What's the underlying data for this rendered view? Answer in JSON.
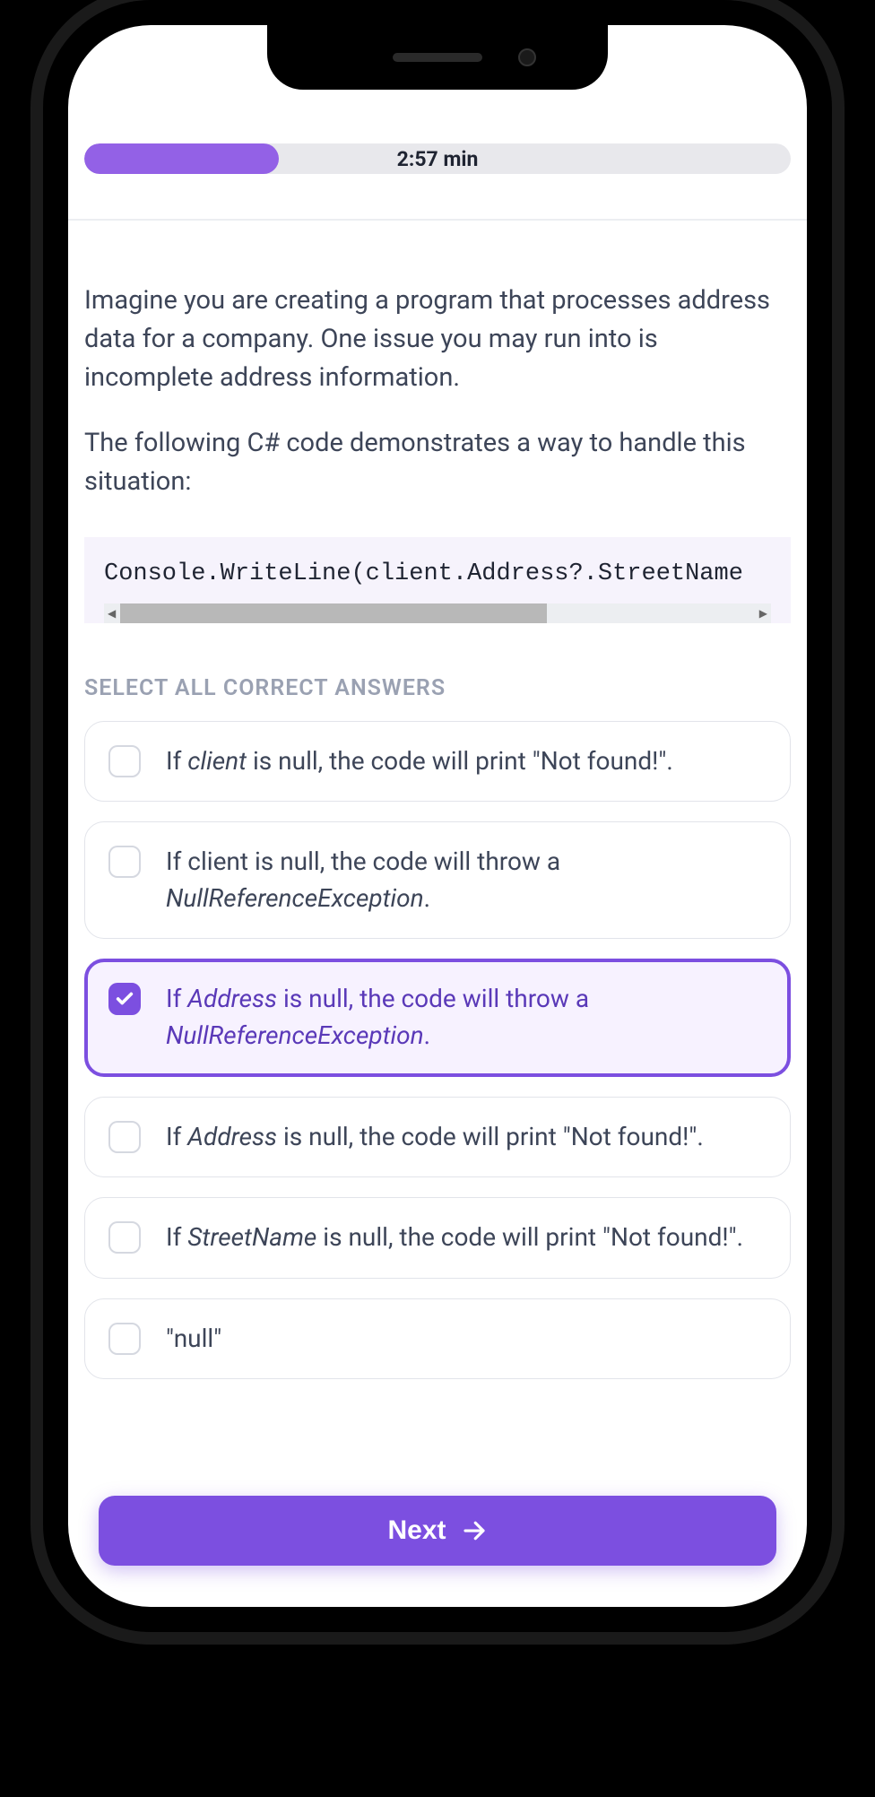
{
  "timer": {
    "display": "2:57 min",
    "progress_pct": 27.5
  },
  "question": {
    "p1": "Imagine you are creating a program that processes address data for a company. One issue you may run into is incomplete address information.",
    "p2": "The following C# code demonstrates a way to handle this situation:",
    "code": "Console.WriteLine(client.Address?.StreetName"
  },
  "instruction": "SELECT ALL CORRECT ANSWERS",
  "answers": [
    {
      "pre": "If ",
      "em1": "client",
      "mid": " is null, the code will print \"Not found!\".",
      "em2": "",
      "post": "",
      "selected": false
    },
    {
      "pre": "If client is null, the code will throw a ",
      "em1": "NullReferenceException",
      "mid": ".",
      "em2": "",
      "post": "",
      "selected": false
    },
    {
      "pre": "If ",
      "em1": "Address",
      "mid": " is null, the code will throw a ",
      "em2": "NullReferenceException",
      "post": ".",
      "selected": true
    },
    {
      "pre": "If ",
      "em1": "Address",
      "mid": " is null, the code will print \"Not found!\".",
      "em2": "",
      "post": "",
      "selected": false
    },
    {
      "pre": "If ",
      "em1": "StreetName",
      "mid": " is null, the code will print \"Not found!\".",
      "em2": "",
      "post": "",
      "selected": false
    },
    {
      "pre": "",
      "em1": "",
      "mid": "\"null\"",
      "em2": "",
      "post": "",
      "selected": false
    }
  ],
  "next_label": "Next"
}
